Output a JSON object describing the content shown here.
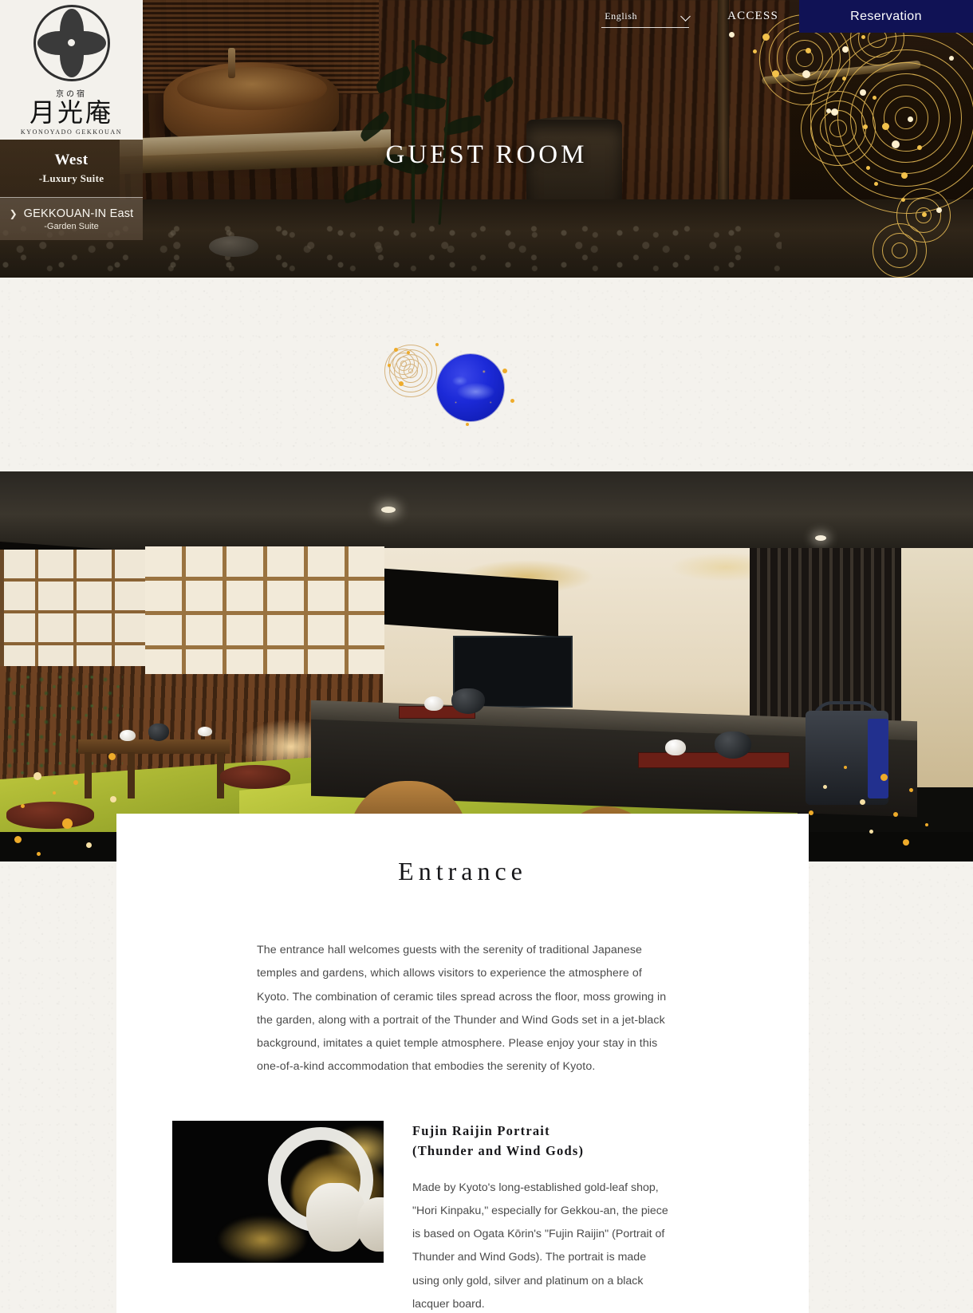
{
  "header": {
    "language_label": "English",
    "language_icon": "chevron-down-icon",
    "access_label": "ACCESS",
    "reservation_label": "Reservation",
    "reservation_bg": "#101255"
  },
  "logo": {
    "crest_icon": "kamon-crest-icon",
    "kana": "京の宿",
    "name_ja": "月光庵",
    "name_romaji": "KYONOYADO   GEKKOUAN"
  },
  "sidebar": {
    "items": [
      {
        "title": "West",
        "subtitle": "-Luxury Suite",
        "active": true
      },
      {
        "title": "GEKKOUAN-IN East",
        "subtitle": "-Garden Suite",
        "arrow_icon": "chevron-right-icon",
        "active": false
      }
    ]
  },
  "hero": {
    "title": "GUEST ROOM",
    "photo_alt": "kyoto-bath-garden-photo",
    "decor": "gold-concentric-rings-decor"
  },
  "divider": {
    "ornament": "blue-moon-ornament"
  },
  "room": {
    "photo_alt": "japanese-tatami-guest-room-photo"
  },
  "entrance": {
    "title": "Entrance",
    "body": "The entrance hall welcomes guests with the serenity of traditional Japanese temples and gardens, which allows visitors to experience the atmosphere of Kyoto. The combination of ceramic tiles spread across the floor, moss growing in the garden, along with a portrait of the Thunder and Wind Gods set in a jet-black background, imitates a quiet temple atmosphere. Please enjoy your stay in this one-of-a-kind accommodation that embodies the serenity of Kyoto."
  },
  "artwork": {
    "image_alt": "fujin-raijin-gold-leaf-artwork",
    "heading_line1": "Fujin Raijin Portrait",
    "heading_line2": "(Thunder and Wind Gods)",
    "body": "Made by Kyoto's long-established gold-leaf shop, \"Hori Kinpaku,\" especially for Gekkou-an, the piece is based on Ogata Kōrin's \"Fujin Raijin\" (Portrait of Thunder and Wind Gods). The portrait is made using only gold, silver and platinum on a black lacquer board."
  }
}
